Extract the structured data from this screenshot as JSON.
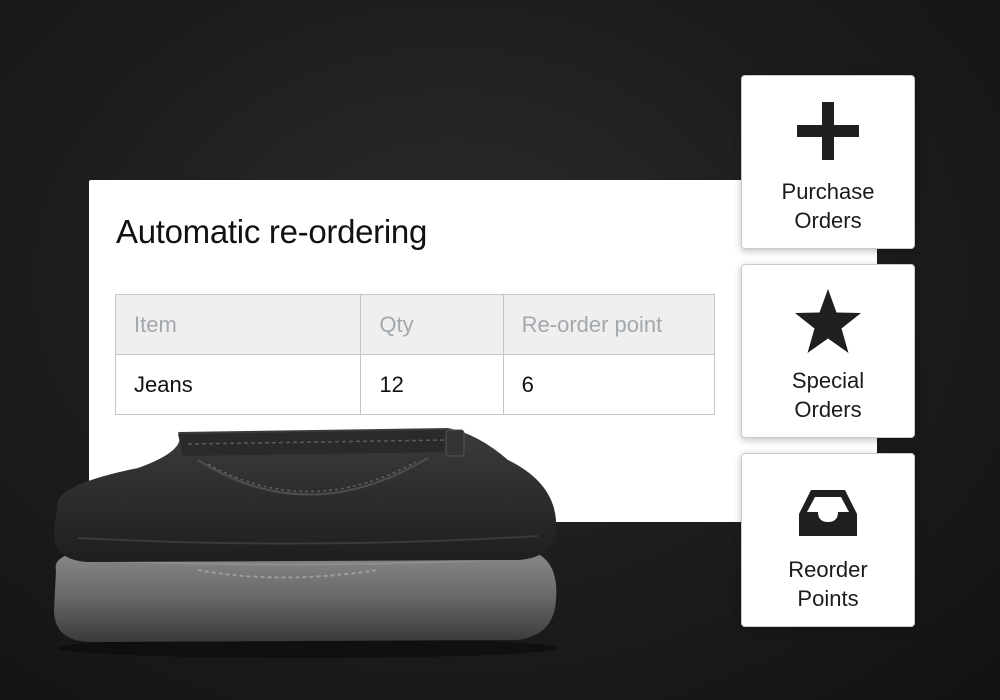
{
  "card": {
    "title": "Automatic re-ordering",
    "table": {
      "headers": [
        "Item",
        "Qty",
        "Re-order point"
      ],
      "rows": [
        [
          "Jeans",
          "12",
          "6"
        ]
      ]
    }
  },
  "sidebar": {
    "buttons": [
      {
        "icon": "plus-icon",
        "line1": "Purchase",
        "line2": "Orders"
      },
      {
        "icon": "star-icon",
        "line1": "Special",
        "line2": "Orders"
      },
      {
        "icon": "inbox-tray-icon",
        "line1": "Reorder",
        "line2": "Points"
      }
    ]
  },
  "colors": {
    "background": "#1c1c1c",
    "card": "#ffffff",
    "header_bg": "#efefef",
    "header_text": "#a3a8ad",
    "icon": "#1f1f1f"
  }
}
